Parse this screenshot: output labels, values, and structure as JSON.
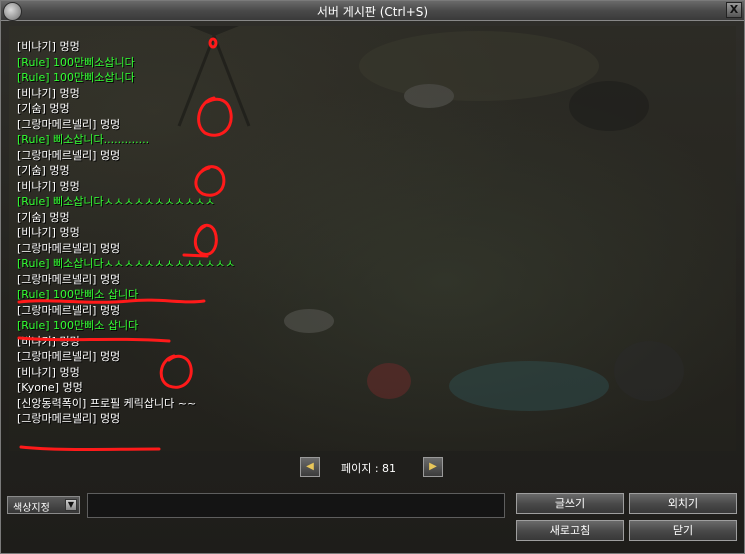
{
  "window": {
    "title": "서버 게시판 (Ctrl+S)",
    "close_label": "X"
  },
  "colors": {
    "default": "#ffffff",
    "rule": "#33ff33",
    "annotation": "#ff1a1a"
  },
  "messages": [
    {
      "name": "비냐기",
      "text": "멍멍",
      "type": "default"
    },
    {
      "name": "Rule",
      "text": "100만삐소삽니다",
      "type": "rule"
    },
    {
      "name": "Rule",
      "text": "100만삐소삽니다",
      "type": "rule"
    },
    {
      "name": "비냐기",
      "text": "멍멍",
      "type": "default"
    },
    {
      "name": "기숨",
      "text": "멍멍",
      "type": "default"
    },
    {
      "name": "그랑마메르넬리",
      "text": "멍멍",
      "type": "default"
    },
    {
      "name": "Rule",
      "text": "삐소삽니다.............",
      "type": "rule"
    },
    {
      "name": "그랑마메르넬리",
      "text": "멍멍",
      "type": "default"
    },
    {
      "name": "기숨",
      "text": "멍멍",
      "type": "default"
    },
    {
      "name": "비냐기",
      "text": "멍멍",
      "type": "default"
    },
    {
      "name": "Rule",
      "text": "삐소삽니다ㅅㅅㅅㅅㅅㅅㅅㅅㅅㅅㅅ",
      "type": "rule"
    },
    {
      "name": "기숨",
      "text": "멍멍",
      "type": "default"
    },
    {
      "name": "비냐기",
      "text": "멍멍",
      "type": "default"
    },
    {
      "name": "그랑마메르넬리",
      "text": "멍멍",
      "type": "default"
    },
    {
      "name": "Rule",
      "text": "삐소삽니다ㅅㅅㅅㅅㅅㅅㅅㅅㅅㅅㅅㅅㅅ",
      "type": "rule"
    },
    {
      "name": "그랑마메르넬리",
      "text": "멍멍",
      "type": "default"
    },
    {
      "name": "Rule",
      "text": "100만삐소 삽니다",
      "type": "rule"
    },
    {
      "name": "그랑마메르넬리",
      "text": "멍멍",
      "type": "default"
    },
    {
      "name": "Rule",
      "text": "100만삐소 삽니다",
      "type": "rule"
    },
    {
      "name": "비냐기",
      "text": "멍멍",
      "type": "default"
    },
    {
      "name": "그랑마메르넬리",
      "text": "멍멍",
      "type": "default"
    },
    {
      "name": "비냐기",
      "text": "멍멍",
      "type": "default"
    },
    {
      "name": "Kyone",
      "text": "멍멍",
      "type": "default"
    },
    {
      "name": "신앙동력폭이",
      "text": "프로필 케릭삽니다 ~~",
      "type": "default"
    },
    {
      "name": "그랑마메르넬리",
      "text": "멍멍",
      "type": "default"
    }
  ],
  "pager": {
    "label": "페이지 : 81"
  },
  "bottom": {
    "color_button_label": "색상지정",
    "input_value": "",
    "write_label": "글쓰기",
    "shout_label": "외치기",
    "refresh_label": "새로고침",
    "close_label": "닫기"
  }
}
